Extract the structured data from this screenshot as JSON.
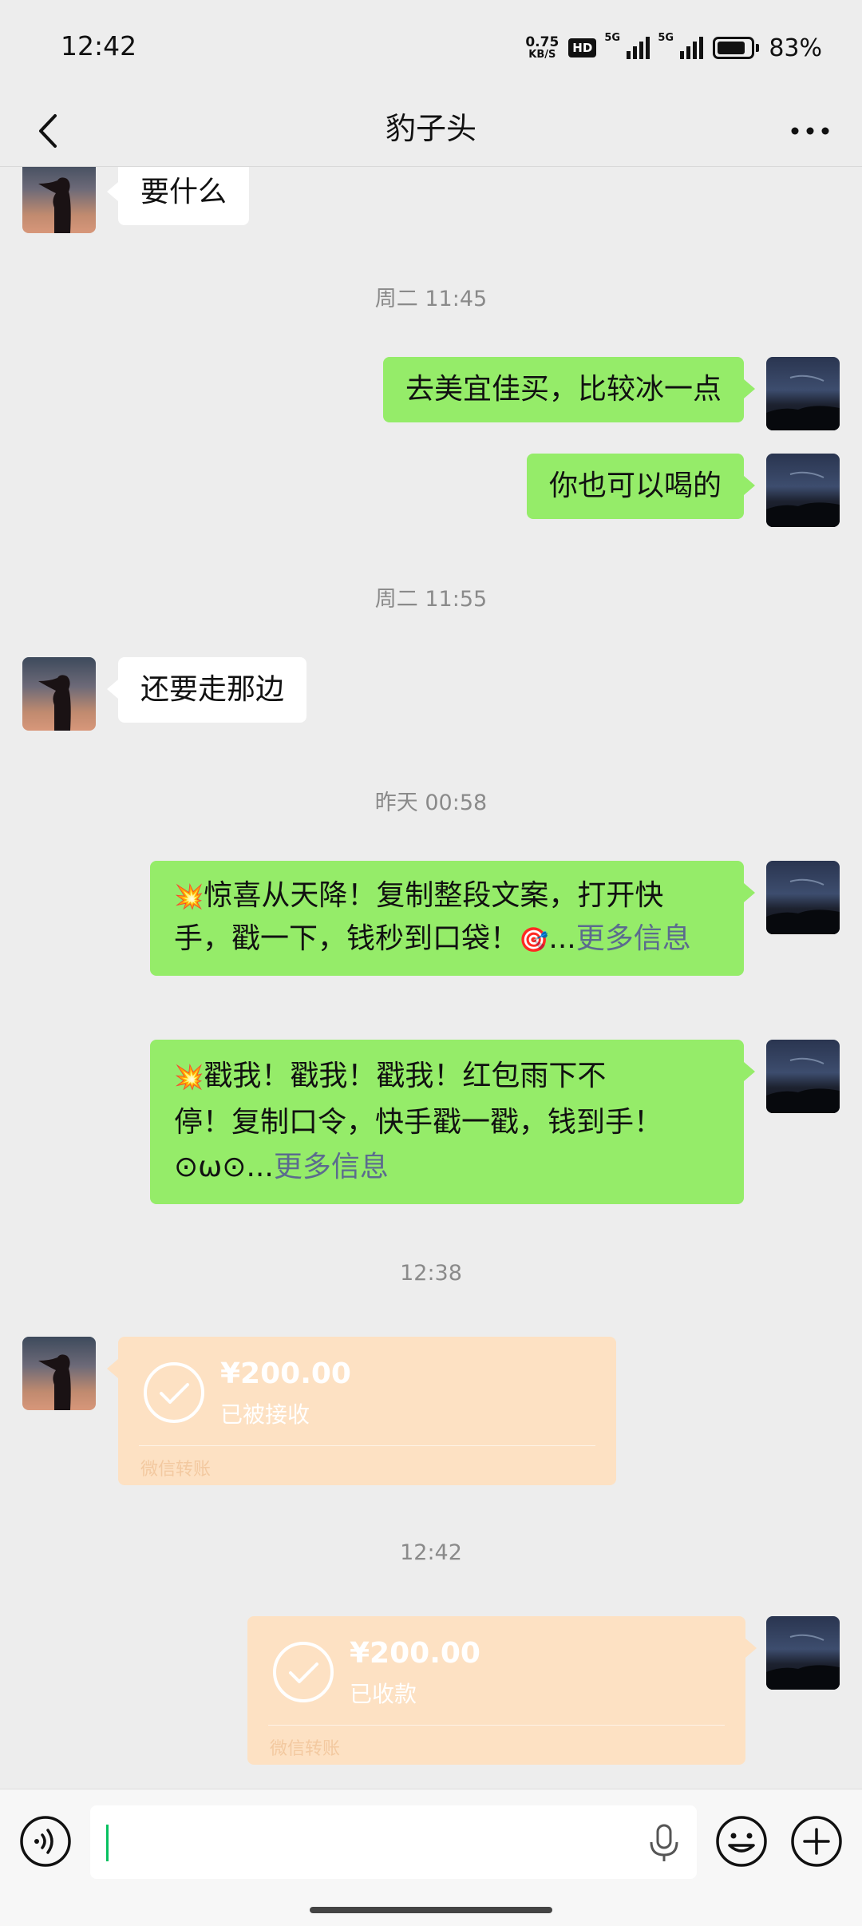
{
  "status_bar": {
    "time": "12:42",
    "net_speed_value": "0.75",
    "net_speed_unit": "KB/S",
    "hd_badge": "HD",
    "signal_1_label": "5G",
    "signal_2_label": "5G",
    "battery_percent": "83%",
    "battery_level": 0.83
  },
  "header": {
    "title": "豹子头",
    "back_icon": "chevron-left-icon",
    "more_icon": "more-dots-icon"
  },
  "messages": {
    "m0": {
      "text": "要什么"
    },
    "t1": "周二 11:45",
    "m1": {
      "text": "去美宜佳买，比较冰一点"
    },
    "m2": {
      "text": "你也可以喝的"
    },
    "t2": "周二 11:55",
    "m3": {
      "text": "还要走那边"
    },
    "t3": "昨天 00:58",
    "m4": {
      "emoji": "💥",
      "line1": "惊喜从天降！复制整段文案，打开快",
      "line2": "手，戳一下，钱秒到口袋！",
      "emoji2": "🎯",
      "ellipsis": "...",
      "more_link": "更多信息"
    },
    "m5": {
      "emoji": "💥",
      "line1": "戳我！戳我！戳我！红包雨下不",
      "line2": "停！复制口令，快手戳一戳，钱到手！",
      "line3": "⊙ω⊙...",
      "more_link": "更多信息"
    },
    "t4": "12:38",
    "transfer1": {
      "amount": "¥200.00",
      "status": "已被接收",
      "brand": "微信转账"
    },
    "t5": "12:42",
    "transfer2": {
      "amount": "¥200.00",
      "status": "已收款",
      "brand": "微信转账"
    }
  },
  "input_bar": {
    "voice_icon": "voice-icon",
    "mic_icon": "microphone-icon",
    "emoji_icon": "emoji-icon",
    "plus_icon": "plus-icon"
  },
  "colors": {
    "background": "#ededed",
    "self_bubble": "#95ec69",
    "other_bubble": "#ffffff",
    "transfer_bubble": "#fde1c3",
    "link": "#5b6b8e",
    "caret": "#07c160"
  }
}
